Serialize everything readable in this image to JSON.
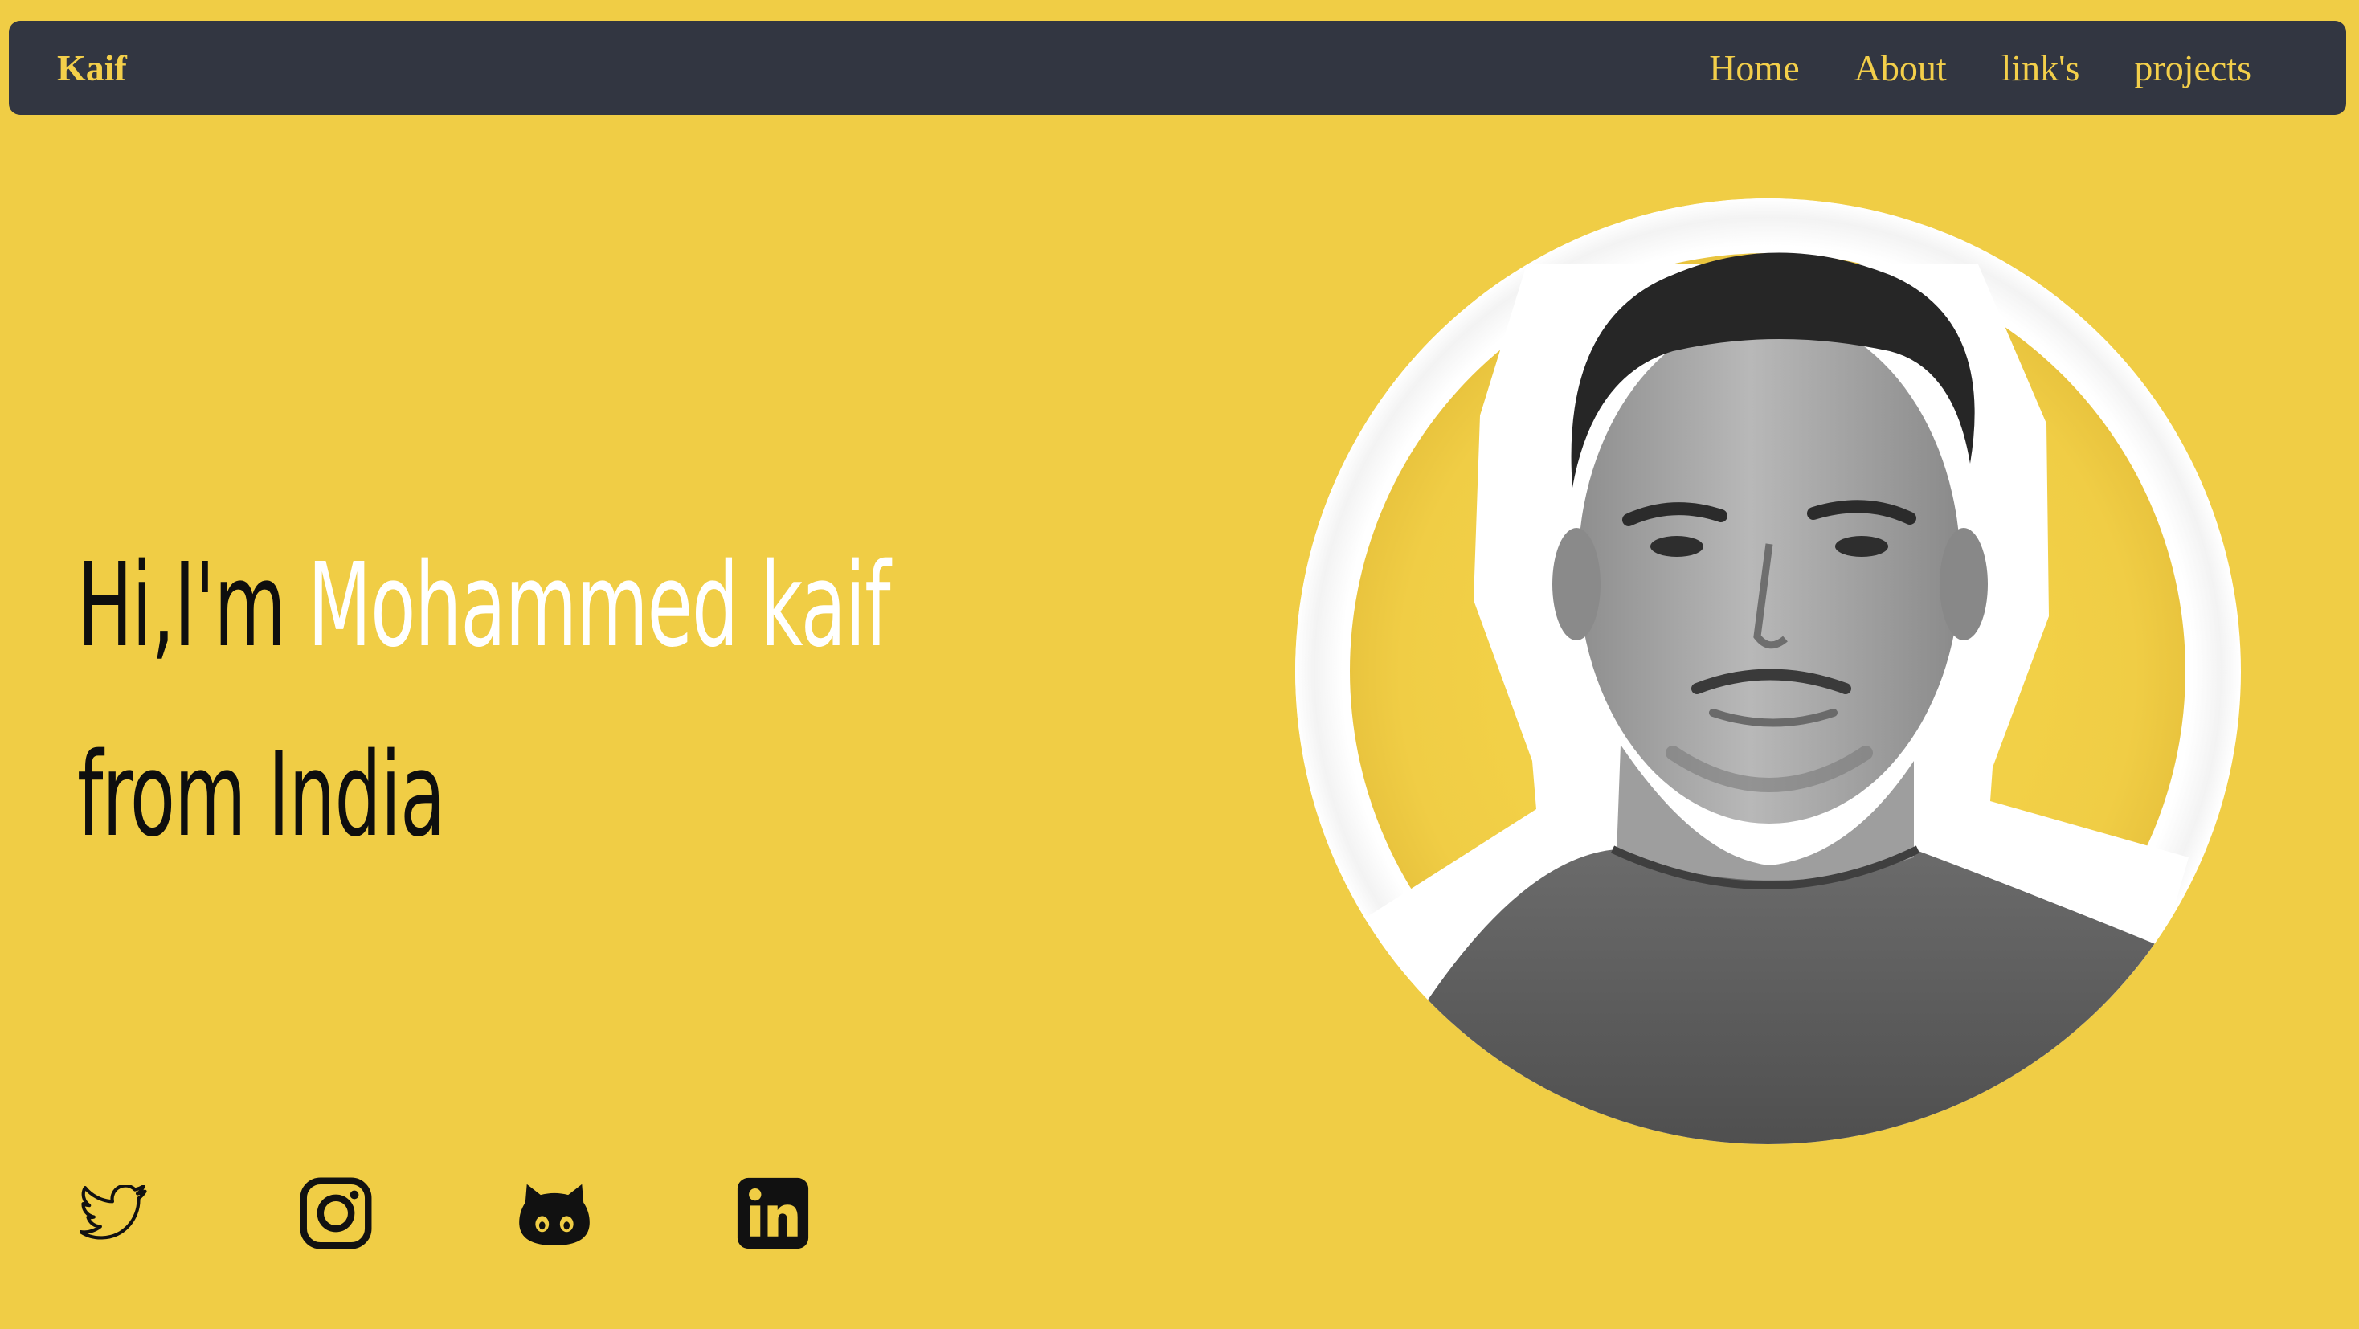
{
  "nav": {
    "brand": "Kaif",
    "links": [
      {
        "label": "Home"
      },
      {
        "label": "About"
      },
      {
        "label": "link's"
      },
      {
        "label": "projects"
      }
    ]
  },
  "hero": {
    "greeting": "Hi,I'm ",
    "name": "Mohammed kaif",
    "location": "from India",
    "profile_photo": "profile-photo-grayscale-portrait"
  },
  "socials": [
    {
      "icon": "twitter-icon"
    },
    {
      "icon": "instagram-icon"
    },
    {
      "icon": "github-icon"
    },
    {
      "icon": "linkedin-icon"
    }
  ],
  "colors": {
    "background": "#f0cd45",
    "navbar": "#323641",
    "accent": "#f3cf4a",
    "name_highlight": "#ffffff",
    "text": "#0e0e0e"
  }
}
